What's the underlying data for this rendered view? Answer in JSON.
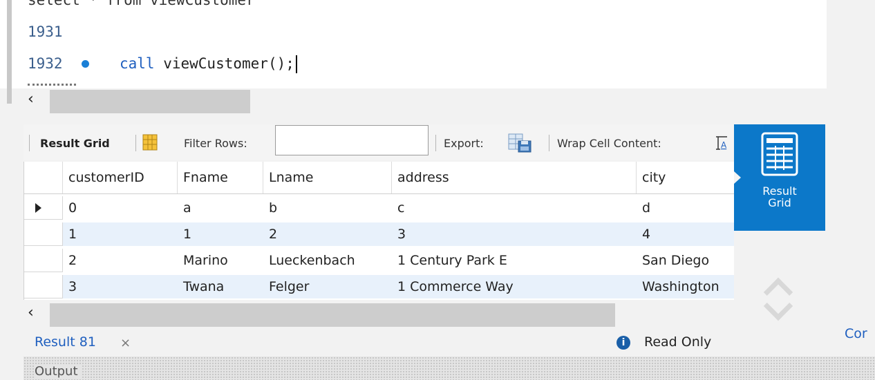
{
  "editor": {
    "partial_line": "select * from viewCustomer",
    "lines": [
      {
        "number": "1931",
        "code_kw": "",
        "code": ""
      },
      {
        "number": "1932",
        "code_kw": "call",
        "code": " viewCustomer();"
      }
    ]
  },
  "toolbar": {
    "result_grid_label": "Result Grid",
    "filter_label": "Filter Rows:",
    "filter_value": "",
    "export_label": "Export:",
    "wrap_label": "Wrap Cell Content:"
  },
  "grid": {
    "columns": [
      "customerID",
      "Fname",
      "Lname",
      "address",
      "city"
    ],
    "rows": [
      [
        "0",
        "a",
        "b",
        "c",
        "d"
      ],
      [
        "1",
        "1",
        "2",
        "3",
        "4"
      ],
      [
        "2",
        "Marino",
        "Lueckenbach",
        "1 Century Park E",
        "San Diego"
      ],
      [
        "3",
        "Twana",
        "Felger",
        "1 Commerce Way",
        "Washington"
      ]
    ],
    "alt_row_color": "#e8f1fb"
  },
  "side_panel": {
    "label": "Result\nGrid",
    "accent": "#0c78c9"
  },
  "tabs": {
    "result_tab": "Result 81",
    "close_glyph": "×",
    "status": "Read Only",
    "right_cut": "Cor"
  },
  "output": {
    "label": "Output"
  }
}
